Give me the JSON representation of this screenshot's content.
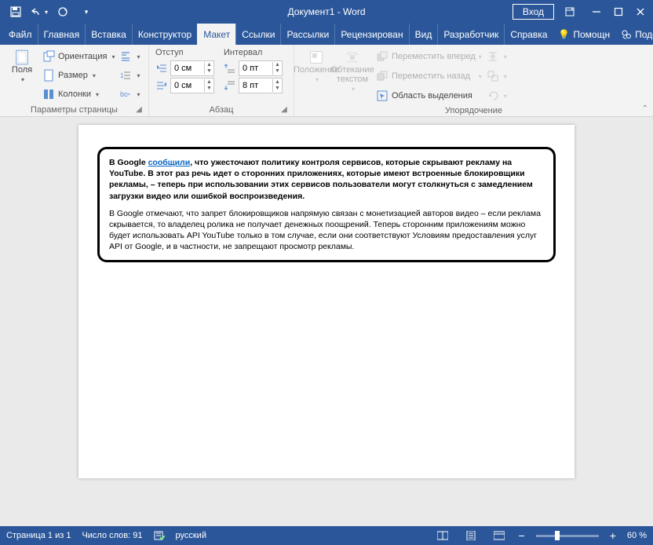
{
  "title": "Документ1 - Word",
  "signin": "Вход",
  "menu": {
    "file": "Файл",
    "home": "Главная",
    "insert": "Вставка",
    "design": "Конструктор",
    "layout": "Макет",
    "references": "Ссылки",
    "mailings": "Рассылки",
    "review": "Рецензирован",
    "view": "Вид",
    "developer": "Разработчик",
    "help": "Справка",
    "tellme": "Помощн",
    "share": "Поделиться"
  },
  "ribbon": {
    "page_setup": {
      "margins": "Поля",
      "orientation": "Ориентация",
      "size": "Размер",
      "columns": "Колонки",
      "caption": "Параметры страницы"
    },
    "paragraph": {
      "indent_label": "Отступ",
      "spacing_label": "Интервал",
      "indent_left": "0 см",
      "indent_right": "0 см",
      "spacing_before": "0 пт",
      "spacing_after": "8 пт",
      "caption": "Абзац"
    },
    "arrange": {
      "position": "Положение",
      "wrap": "Обтекание текстом",
      "bring_forward": "Переместить вперед",
      "send_backward": "Переместить назад",
      "selection_pane": "Область выделения",
      "caption": "Упорядочение"
    }
  },
  "document": {
    "p1_pre": "В Google ",
    "p1_link": "сообщили",
    "p1_post": ", что ужесточают политику контроля сервисов, которые скрывают рекламу на YouTube. В этот раз речь идет о сторонних приложениях, которые имеют встроенные блокировщики рекламы, – теперь при использовании этих сервисов пользователи могут столкнуться с замедлением загрузки видео или ошибкой воспроизведения.",
    "p2": "В Google отмечают, что запрет блокировщиков напрямую связан с монетизацией авторов видео – если реклама скрывается, то владелец ролика не получает денежных поощрений. Теперь сторонним приложениям можно будет использовать API YouTube только в том случае, если они соответствуют Условиям предоставления услуг API от Google, и в частности, не запрещают просмотр рекламы."
  },
  "status": {
    "page": "Страница 1 из 1",
    "words": "Число слов: 91",
    "lang": "русский",
    "zoom": "60 %"
  }
}
